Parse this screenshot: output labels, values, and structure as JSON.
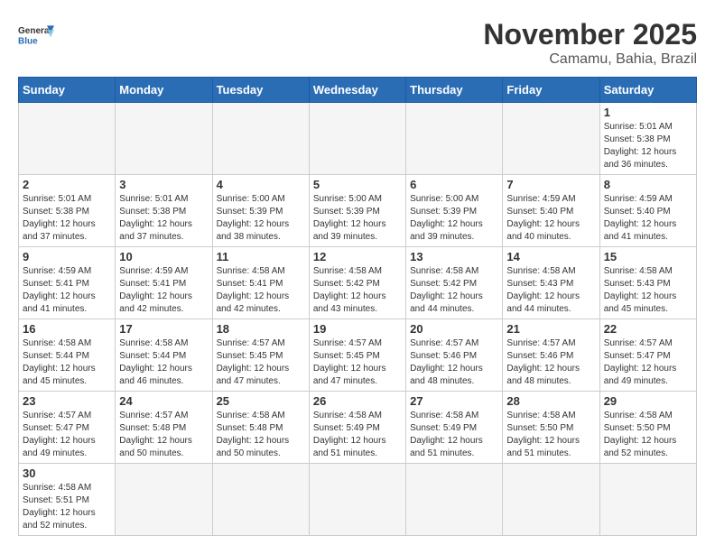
{
  "header": {
    "logo_general": "General",
    "logo_blue": "Blue",
    "month_title": "November 2025",
    "location": "Camamu, Bahia, Brazil"
  },
  "weekdays": [
    "Sunday",
    "Monday",
    "Tuesday",
    "Wednesday",
    "Thursday",
    "Friday",
    "Saturday"
  ],
  "days": {
    "d1": {
      "num": "1",
      "sunrise": "5:01 AM",
      "sunset": "5:38 PM",
      "daylight": "12 hours and 36 minutes."
    },
    "d2": {
      "num": "2",
      "sunrise": "5:01 AM",
      "sunset": "5:38 PM",
      "daylight": "12 hours and 37 minutes."
    },
    "d3": {
      "num": "3",
      "sunrise": "5:01 AM",
      "sunset": "5:38 PM",
      "daylight": "12 hours and 37 minutes."
    },
    "d4": {
      "num": "4",
      "sunrise": "5:00 AM",
      "sunset": "5:39 PM",
      "daylight": "12 hours and 38 minutes."
    },
    "d5": {
      "num": "5",
      "sunrise": "5:00 AM",
      "sunset": "5:39 PM",
      "daylight": "12 hours and 39 minutes."
    },
    "d6": {
      "num": "6",
      "sunrise": "5:00 AM",
      "sunset": "5:39 PM",
      "daylight": "12 hours and 39 minutes."
    },
    "d7": {
      "num": "7",
      "sunrise": "4:59 AM",
      "sunset": "5:40 PM",
      "daylight": "12 hours and 40 minutes."
    },
    "d8": {
      "num": "8",
      "sunrise": "4:59 AM",
      "sunset": "5:40 PM",
      "daylight": "12 hours and 41 minutes."
    },
    "d9": {
      "num": "9",
      "sunrise": "4:59 AM",
      "sunset": "5:41 PM",
      "daylight": "12 hours and 41 minutes."
    },
    "d10": {
      "num": "10",
      "sunrise": "4:59 AM",
      "sunset": "5:41 PM",
      "daylight": "12 hours and 42 minutes."
    },
    "d11": {
      "num": "11",
      "sunrise": "4:58 AM",
      "sunset": "5:41 PM",
      "daylight": "12 hours and 42 minutes."
    },
    "d12": {
      "num": "12",
      "sunrise": "4:58 AM",
      "sunset": "5:42 PM",
      "daylight": "12 hours and 43 minutes."
    },
    "d13": {
      "num": "13",
      "sunrise": "4:58 AM",
      "sunset": "5:42 PM",
      "daylight": "12 hours and 44 minutes."
    },
    "d14": {
      "num": "14",
      "sunrise": "4:58 AM",
      "sunset": "5:43 PM",
      "daylight": "12 hours and 44 minutes."
    },
    "d15": {
      "num": "15",
      "sunrise": "4:58 AM",
      "sunset": "5:43 PM",
      "daylight": "12 hours and 45 minutes."
    },
    "d16": {
      "num": "16",
      "sunrise": "4:58 AM",
      "sunset": "5:44 PM",
      "daylight": "12 hours and 45 minutes."
    },
    "d17": {
      "num": "17",
      "sunrise": "4:58 AM",
      "sunset": "5:44 PM",
      "daylight": "12 hours and 46 minutes."
    },
    "d18": {
      "num": "18",
      "sunrise": "4:57 AM",
      "sunset": "5:45 PM",
      "daylight": "12 hours and 47 minutes."
    },
    "d19": {
      "num": "19",
      "sunrise": "4:57 AM",
      "sunset": "5:45 PM",
      "daylight": "12 hours and 47 minutes."
    },
    "d20": {
      "num": "20",
      "sunrise": "4:57 AM",
      "sunset": "5:46 PM",
      "daylight": "12 hours and 48 minutes."
    },
    "d21": {
      "num": "21",
      "sunrise": "4:57 AM",
      "sunset": "5:46 PM",
      "daylight": "12 hours and 48 minutes."
    },
    "d22": {
      "num": "22",
      "sunrise": "4:57 AM",
      "sunset": "5:47 PM",
      "daylight": "12 hours and 49 minutes."
    },
    "d23": {
      "num": "23",
      "sunrise": "4:57 AM",
      "sunset": "5:47 PM",
      "daylight": "12 hours and 49 minutes."
    },
    "d24": {
      "num": "24",
      "sunrise": "4:57 AM",
      "sunset": "5:48 PM",
      "daylight": "12 hours and 50 minutes."
    },
    "d25": {
      "num": "25",
      "sunrise": "4:58 AM",
      "sunset": "5:48 PM",
      "daylight": "12 hours and 50 minutes."
    },
    "d26": {
      "num": "26",
      "sunrise": "4:58 AM",
      "sunset": "5:49 PM",
      "daylight": "12 hours and 51 minutes."
    },
    "d27": {
      "num": "27",
      "sunrise": "4:58 AM",
      "sunset": "5:49 PM",
      "daylight": "12 hours and 51 minutes."
    },
    "d28": {
      "num": "28",
      "sunrise": "4:58 AM",
      "sunset": "5:50 PM",
      "daylight": "12 hours and 51 minutes."
    },
    "d29": {
      "num": "29",
      "sunrise": "4:58 AM",
      "sunset": "5:50 PM",
      "daylight": "12 hours and 52 minutes."
    },
    "d30": {
      "num": "30",
      "sunrise": "4:58 AM",
      "sunset": "5:51 PM",
      "daylight": "12 hours and 52 minutes."
    }
  }
}
